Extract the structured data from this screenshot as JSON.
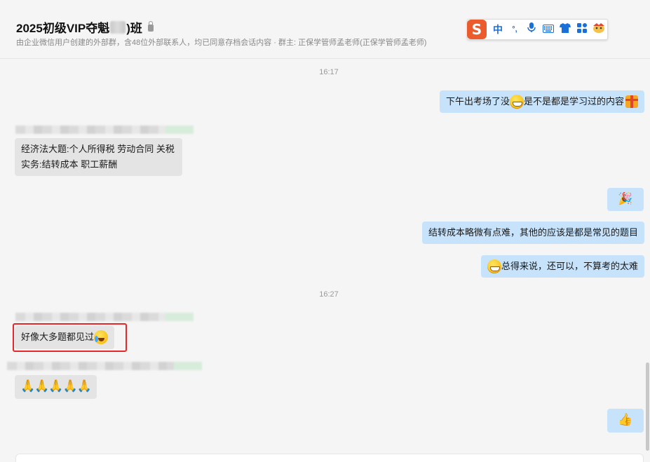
{
  "header": {
    "title_prefix": "2025初级VIP夺魁",
    "title_suffix": ")班",
    "subtitle": "由企业微信用户创建的外部群，含48位外部联系人，均已同意存档会话内容  · 群主: 正保学管师孟老师(正保学管师孟老师)"
  },
  "ime_toolbar": {
    "logo": "S",
    "items": [
      "中",
      "°,",
      "mic",
      "keyboard",
      "skin",
      "apps",
      "emoji"
    ]
  },
  "chat": {
    "time_1": "16:17",
    "time_2": "16:27",
    "messages": {
      "m1_text_a": "下午出考场了没",
      "m1_text_b": "是不是都是学习过的内容",
      "m2_line1": "经济法大题:个人所得税 劳动合同 关税",
      "m2_line2": "实务:结转成本 职工薪酬",
      "m3_emoji": "🎉",
      "m4_text": "结转成本略微有点难，其他的应该是都是常见的题目",
      "m5_text": "总得来说，还可以，不算考的太难",
      "m6_text": "好像大多题都见过",
      "m7_emoji": "🙏🙏🙏🙏🙏",
      "m8_emoji": "👍"
    }
  },
  "colors": {
    "my_bubble": "#c7e3fb",
    "other_bubble": "#e4e4e4",
    "highlight": "#e62828",
    "ime_blue": "#1a6fd8",
    "ime_logo": "#ec5b2b"
  }
}
